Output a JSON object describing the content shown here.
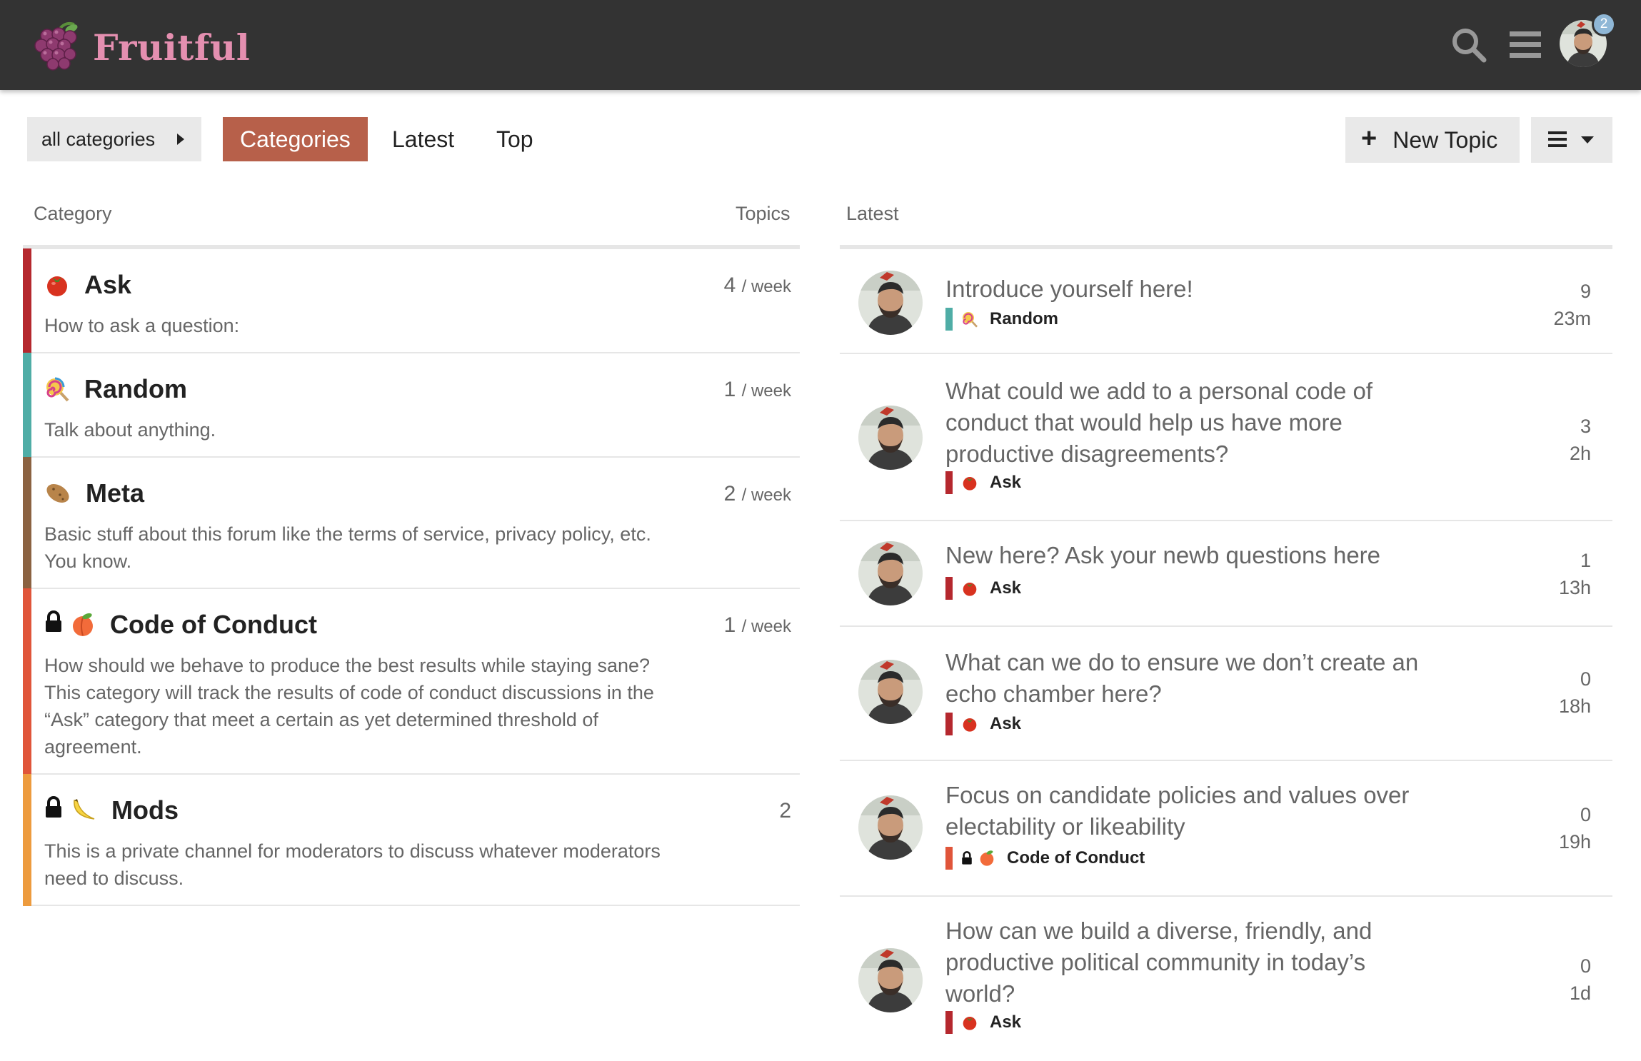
{
  "header": {
    "site_title": "Fruitful",
    "notification_count": "2",
    "icons": [
      "grape-logo-icon",
      "search-icon",
      "hamburger-menu-icon",
      "user-avatar"
    ]
  },
  "nav": {
    "breadcrumb": "all categories",
    "tabs": [
      {
        "label": "Categories",
        "active": true
      },
      {
        "label": "Latest",
        "active": false
      },
      {
        "label": "Top",
        "active": false
      }
    ],
    "new_topic_label": "New Topic"
  },
  "columns": {
    "category": "Category",
    "topics": "Topics",
    "latest": "Latest"
  },
  "categories": [
    {
      "name": "Ask",
      "icon": "tomato-icon",
      "locked": false,
      "color": "#b5282e",
      "description": "How to ask a question:",
      "count": "4",
      "per": "/ week"
    },
    {
      "name": "Random",
      "icon": "lollipop-icon",
      "locked": false,
      "color": "#4fada6",
      "description": "Talk about anything.",
      "count": "1",
      "per": "/ week"
    },
    {
      "name": "Meta",
      "icon": "potato-icon",
      "locked": false,
      "color": "#8b6241",
      "description": "Basic stuff about this forum like the terms of service, privacy policy, etc. You know.",
      "count": "2",
      "per": "/ week"
    },
    {
      "name": "Code of Conduct",
      "icon": "peach-icon",
      "locked": true,
      "color": "#e0553a",
      "description": "How should we behave to produce the best results while staying sane? This category will track the results of code of conduct discussions in the “Ask” category that meet a certain as yet determined threshold of agreement.",
      "count": "1",
      "per": "/ week"
    },
    {
      "name": "Mods",
      "icon": "banana-icon",
      "locked": true,
      "color": "#ed9b3e",
      "description": "This is a private channel for moderators to discuss whatever moderators need to discuss.",
      "count": "2",
      "per": ""
    }
  ],
  "latest_topics": [
    {
      "title": "Introduce yourself here!",
      "category": "Random",
      "cat_icon": "lollipop-icon",
      "locked": false,
      "cat_color": "#4fada6",
      "replies": "9",
      "age": "23m"
    },
    {
      "title": "What could we add to a personal code of conduct that would help us have more productive disagreements?",
      "category": "Ask",
      "cat_icon": "tomato-icon",
      "locked": false,
      "cat_color": "#b5282e",
      "replies": "3",
      "age": "2h"
    },
    {
      "title": "New here? Ask your newb questions here",
      "category": "Ask",
      "cat_icon": "tomato-icon",
      "locked": false,
      "cat_color": "#b5282e",
      "replies": "1",
      "age": "13h"
    },
    {
      "title": "What can we do to ensure we don’t create an echo chamber here?",
      "category": "Ask",
      "cat_icon": "tomato-icon",
      "locked": false,
      "cat_color": "#b5282e",
      "replies": "0",
      "age": "18h"
    },
    {
      "title": "Focus on candidate policies and values over electability or likeability",
      "category": "Code of Conduct",
      "cat_icon": "peach-icon",
      "locked": true,
      "cat_color": "#e0553a",
      "replies": "0",
      "age": "19h"
    },
    {
      "title": "How can we build a diverse, friendly, and productive political community in today’s world?",
      "category": "Ask",
      "cat_icon": "tomato-icon",
      "locked": false,
      "cat_color": "#b5282e",
      "replies": "0",
      "age": "1d"
    }
  ]
}
